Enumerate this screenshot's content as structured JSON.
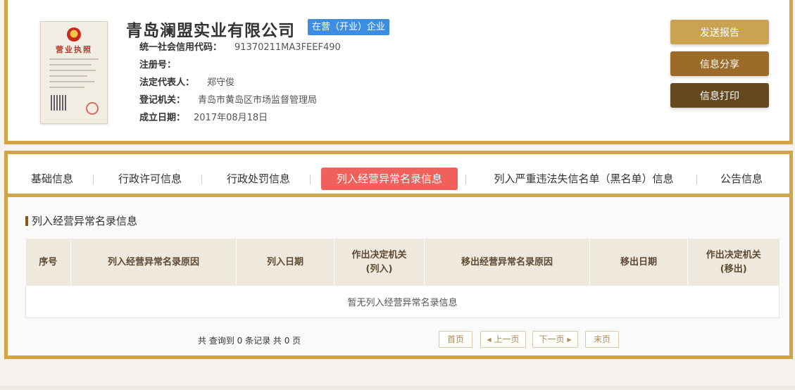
{
  "company": {
    "name": "青岛澜盟实业有限公司",
    "status": "在营（开业）企业",
    "fields": [
      {
        "label": "统一社会信用代码：",
        "value": "91370211MA3FEEF490"
      },
      {
        "label": "注册号：",
        "value": ""
      },
      {
        "label": "法定代表人：",
        "value": "郑守俊"
      },
      {
        "label": "登记机关：",
        "value": "青岛市黄岛区市场监督管理局"
      },
      {
        "label": "成立日期：",
        "value": "2017年08月18日"
      }
    ],
    "license": {
      "title": "营业执照"
    }
  },
  "actions": {
    "send": "发送报告",
    "share": "信息分享",
    "print": "信息打印"
  },
  "tabs": [
    {
      "label": "基础信息",
      "active": false
    },
    {
      "label": "行政许可信息",
      "active": false
    },
    {
      "label": "行政处罚信息",
      "active": false
    },
    {
      "label": "列入经营异常名录信息",
      "active": true
    },
    {
      "label": "列入严重违法失信名单（黑名单）信息",
      "active": false
    },
    {
      "label": "公告信息",
      "active": false
    }
  ],
  "section": {
    "title": "列入经营异常名录信息",
    "columns": [
      {
        "line1": "序号",
        "line2": ""
      },
      {
        "line1": "列入经营异常名录原因",
        "line2": ""
      },
      {
        "line1": "列入日期",
        "line2": ""
      },
      {
        "line1": "作出决定机关",
        "line2": "(列入)"
      },
      {
        "line1": "移出经营异常名录原因",
        "line2": ""
      },
      {
        "line1": "移出日期",
        "line2": ""
      },
      {
        "line1": "作出决定机关",
        "line2": "(移出)"
      }
    ],
    "empty_text": "暂无列入经营异常名录信息"
  },
  "pagination": {
    "summary": "共 查询到 0 条记录 共 0 页",
    "first": "首页",
    "prev": "上一页",
    "next": "下一页",
    "last": "末页"
  },
  "colors": {
    "border_gold": "#d2a446",
    "active_tab": "#f1615c",
    "status_badge": "#3d8ee0",
    "btn_send": "#c9a352",
    "btn_share": "#9c6b27",
    "btn_print": "#66481f"
  }
}
